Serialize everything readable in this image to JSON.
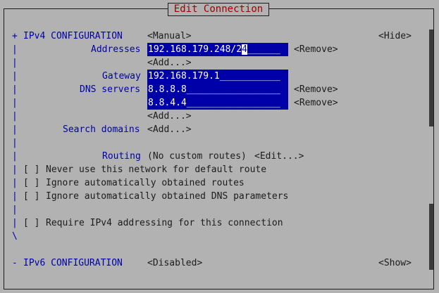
{
  "dialog": {
    "title": "Edit Connection"
  },
  "ipv4": {
    "marker": "+",
    "heading": "IPv4 CONFIGURATION",
    "method": "<Manual>",
    "toggle": "<Hide>",
    "addresses_label": "Addresses",
    "address_value": "192.168.179.248/2",
    "address_cursor": "4",
    "address_fill": "______",
    "remove": "<Remove>",
    "add": "<Add...>",
    "gateway_label": "Gateway",
    "gateway_value": "192.168.179.1___________",
    "dns_label": "DNS servers",
    "dns": [
      "8.8.8.8_________________",
      "8.8.4.4_________________"
    ],
    "search_label": "Search domains",
    "routing_label": "Routing",
    "routing_value": "(No custom routes)",
    "routing_edit": "<Edit...>",
    "checkbox_mark": "[ ]",
    "never_default": "Never use this network for default route",
    "ignore_routes": "Ignore automatically obtained routes",
    "ignore_dns": "Ignore automatically obtained DNS parameters",
    "require_ipv4": "Require IPv4 addressing for this connection",
    "bar": "|",
    "end": "\\"
  },
  "ipv6": {
    "marker": "-",
    "heading": "IPv6 CONFIGURATION",
    "method": "<Disabled>",
    "toggle": "<Show>"
  }
}
